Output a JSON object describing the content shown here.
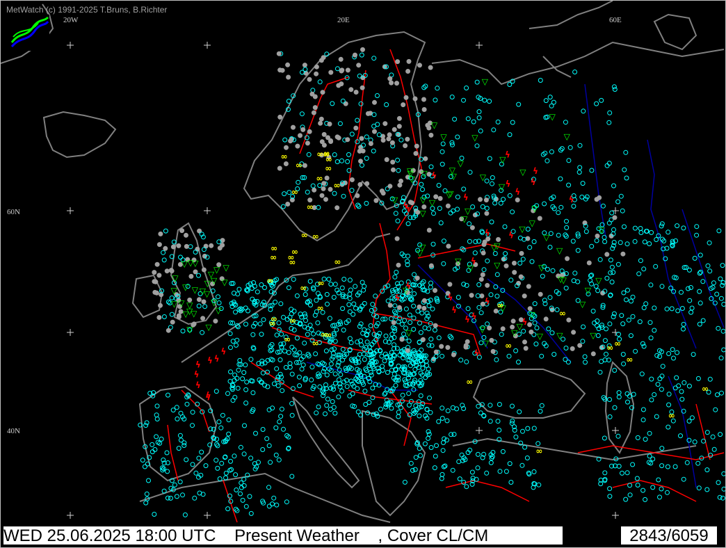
{
  "credit": "MetWatch  (c) 1991-2025 T.Bruns, B.Richter",
  "grid_labels": {
    "w20": "20W",
    "e20": "20E",
    "e60": "60E",
    "n60": "60N",
    "n40": "40N"
  },
  "status": {
    "datetime": "WED 25.06.2025 18:00 UTC",
    "product": "Present Weather",
    "cover": ", Cover CL/CM",
    "count": "2843/6059"
  },
  "colors": {
    "background": "#000000",
    "coast": "#808080",
    "border": "#ff0000",
    "river": "#0000a0",
    "station_cyan": "#00ffff",
    "station_grey": "#a0a0a0",
    "rain_green": "#00ff00",
    "thunder_red": "#ff0000",
    "haze_yellow": "#ffff00"
  },
  "icons": {
    "logo": "metwatch-logo-icon",
    "station": "station-circle-icon",
    "thunder": "thunderstorm-icon",
    "shower": "shower-icon",
    "haze": "haze-icon"
  }
}
